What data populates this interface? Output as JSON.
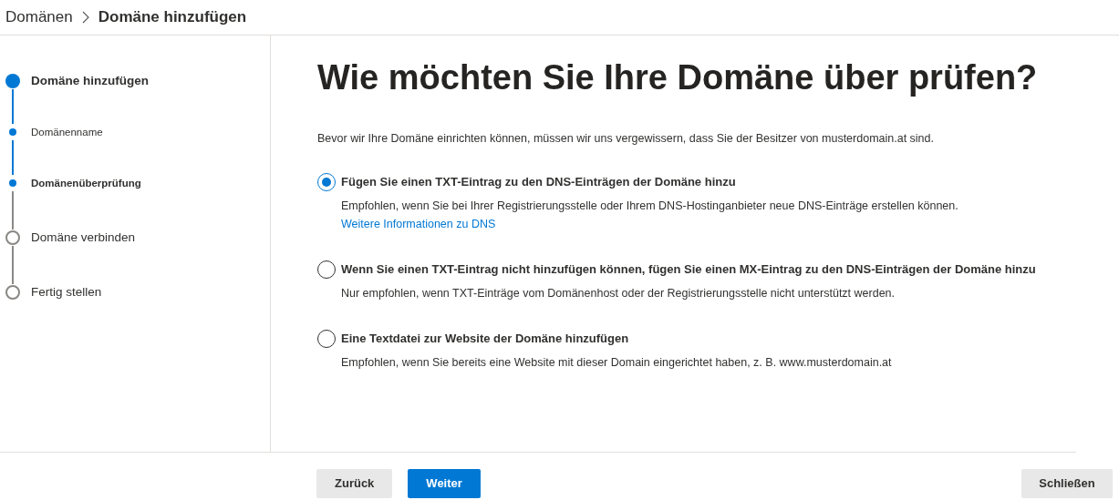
{
  "breadcrumb": {
    "parent": "Domänen",
    "current": "Domäne hinzufügen"
  },
  "steps": [
    {
      "label": "Domäne hinzufügen",
      "kind": "major",
      "reached": true,
      "current": true
    },
    {
      "label": "Domänenname",
      "kind": "sub",
      "reached": true,
      "current": false
    },
    {
      "label": "Domänenüberprüfung",
      "kind": "sub",
      "reached": true,
      "current": true
    },
    {
      "label": "Domäne verbinden",
      "kind": "major",
      "reached": false,
      "current": false
    },
    {
      "label": "Fertig stellen",
      "kind": "major",
      "reached": false,
      "current": false
    }
  ],
  "title": "Wie möchten Sie Ihre Domäne über prüfen?",
  "intro": "Bevor wir Ihre Domäne einrichten können, müssen wir uns vergewissern, dass Sie der Besitzer von musterdomain.at sind.",
  "options": [
    {
      "label": "Fügen Sie einen TXT-Eintrag zu den DNS-Einträgen der Domäne hinzu",
      "description": "Empfohlen, wenn Sie bei Ihrer Registrierungsstelle oder Ihrem DNS-Hostinganbieter neue DNS-Einträge erstellen können.",
      "link": "Weitere Informationen zu DNS",
      "selected": true
    },
    {
      "label": "Wenn Sie einen TXT-Eintrag nicht hinzufügen können, fügen Sie einen MX-Eintrag zu den DNS-Einträgen der Domäne hinzu",
      "description": "Nur empfohlen, wenn TXT-Einträge vom Domänenhost oder der Registrierungsstelle nicht unterstützt werden.",
      "selected": false
    },
    {
      "label": "Eine Textdatei zur Website der Domäne hinzufügen",
      "description": "Empfohlen, wenn Sie bereits eine Website mit dieser Domain eingerichtet haben, z. B. www.musterdomain.at",
      "selected": false
    }
  ],
  "buttons": {
    "back": "Zurück",
    "next": "Weiter",
    "close": "Schließen"
  }
}
